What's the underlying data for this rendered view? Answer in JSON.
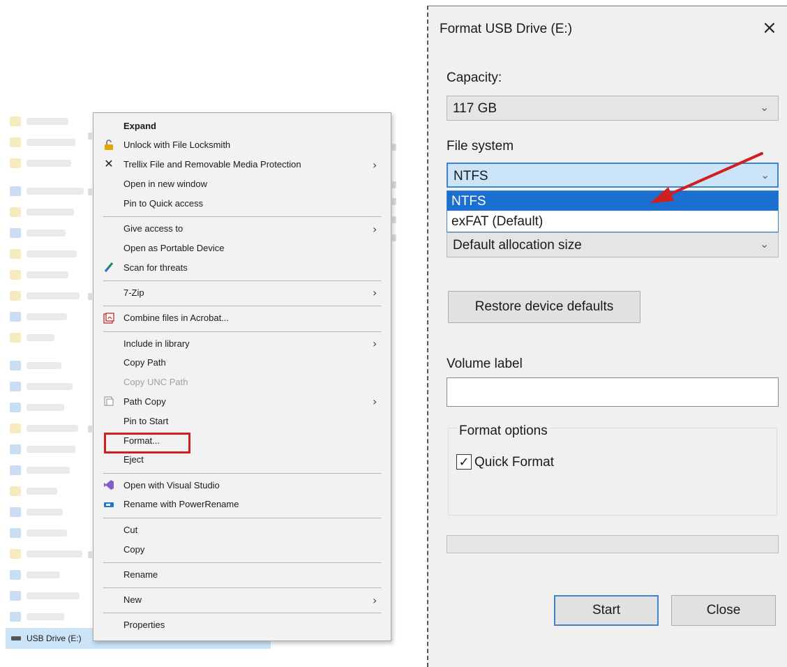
{
  "explorer": {
    "usb_drive_label": "USB Drive (E:)"
  },
  "context_menu": {
    "items": [
      {
        "label": "Expand",
        "icon": "",
        "bold": true,
        "disabled": false,
        "submenu": false
      },
      {
        "label": "Unlock with File Locksmith",
        "icon": "lock-icon",
        "bold": false,
        "disabled": false,
        "submenu": false
      },
      {
        "label": "Trellix File and Removable Media Protection",
        "icon": "trellix-x-icon",
        "bold": false,
        "disabled": false,
        "submenu": true
      },
      {
        "label": "Open in new window",
        "icon": "",
        "bold": false,
        "disabled": false,
        "submenu": false
      },
      {
        "label": "Pin to Quick access",
        "icon": "",
        "bold": false,
        "disabled": false,
        "submenu": false
      },
      {
        "label": "Give access to",
        "icon": "",
        "bold": false,
        "disabled": false,
        "submenu": true
      },
      {
        "label": "Open as Portable Device",
        "icon": "",
        "bold": false,
        "disabled": false,
        "submenu": false
      },
      {
        "label": "Scan for threats",
        "icon": "scan-threats-icon",
        "bold": false,
        "disabled": false,
        "submenu": false
      },
      {
        "label": "7-Zip",
        "icon": "",
        "bold": false,
        "disabled": false,
        "submenu": true
      },
      {
        "label": "Combine files in Acrobat...",
        "icon": "acrobat-icon",
        "bold": false,
        "disabled": false,
        "submenu": false
      },
      {
        "label": "Include in library",
        "icon": "",
        "bold": false,
        "disabled": false,
        "submenu": true
      },
      {
        "label": "Copy Path",
        "icon": "",
        "bold": false,
        "disabled": false,
        "submenu": false
      },
      {
        "label": "Copy UNC Path",
        "icon": "",
        "bold": false,
        "disabled": true,
        "submenu": false
      },
      {
        "label": "Path Copy",
        "icon": "path-copy-icon",
        "bold": false,
        "disabled": false,
        "submenu": true
      },
      {
        "label": "Pin to Start",
        "icon": "",
        "bold": false,
        "disabled": false,
        "submenu": false
      },
      {
        "label": "Format...",
        "icon": "",
        "bold": false,
        "disabled": false,
        "submenu": false
      },
      {
        "label": "Eject",
        "icon": "",
        "bold": false,
        "disabled": false,
        "submenu": false
      },
      {
        "label": "Open with Visual Studio",
        "icon": "visual-studio-icon",
        "bold": false,
        "disabled": false,
        "submenu": false
      },
      {
        "label": "Rename with PowerRename",
        "icon": "powerrename-icon",
        "bold": false,
        "disabled": false,
        "submenu": false
      },
      {
        "label": "Cut",
        "icon": "",
        "bold": false,
        "disabled": false,
        "submenu": false
      },
      {
        "label": "Copy",
        "icon": "",
        "bold": false,
        "disabled": false,
        "submenu": false
      },
      {
        "label": "Rename",
        "icon": "",
        "bold": false,
        "disabled": false,
        "submenu": false
      },
      {
        "label": "New",
        "icon": "",
        "bold": false,
        "disabled": false,
        "submenu": true
      },
      {
        "label": "Properties",
        "icon": "",
        "bold": false,
        "disabled": false,
        "submenu": false
      }
    ],
    "highlighted_item": "Format...",
    "highlight_color": "#d11e1e"
  },
  "dialog": {
    "title": "Format USB Drive (E:)",
    "close_glyph": "×",
    "capacity_label": "Capacity:",
    "capacity_value": "117 GB",
    "file_system_label": "File system",
    "file_system_value": "NTFS",
    "file_system_options": [
      "NTFS",
      "exFAT (Default)"
    ],
    "file_system_selected_option": "NTFS",
    "allocation_value": "Default allocation size",
    "restore_button": "Restore device defaults",
    "volume_label_label": "Volume label",
    "volume_label_value": "",
    "format_options_label": "Format options",
    "quick_format_label": "Quick Format",
    "quick_format_checked": true,
    "progress": 0,
    "start_button": "Start",
    "close_button": "Close",
    "accent_color": "#1b6fd1",
    "annotation_arrow_color": "#d11e1e"
  }
}
